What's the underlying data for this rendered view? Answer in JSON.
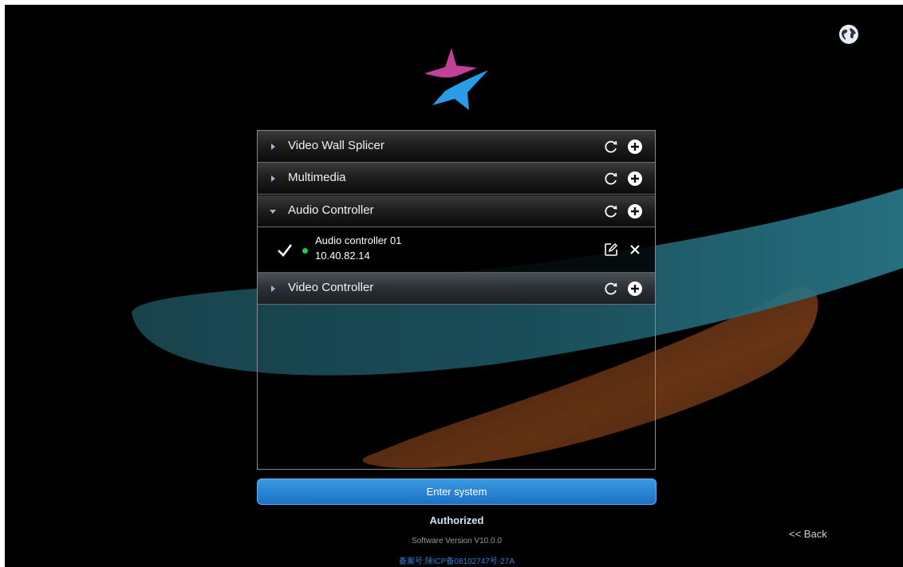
{
  "groups": [
    {
      "title": "Video Wall Splicer",
      "expanded": false
    },
    {
      "title": "Multimedia",
      "expanded": false
    },
    {
      "title": "Audio Controller",
      "expanded": true
    },
    {
      "title": "Video Controller",
      "expanded": false
    }
  ],
  "device": {
    "name": "Audio controller 01",
    "ip": "10.40.82.14",
    "status": "online",
    "selected": true
  },
  "enter_button_label": "Enter system",
  "status_text": "Authorized",
  "software_version": "Software Version V10.0.0",
  "icp_text": "备案号:陕ICP备08102747号-27A",
  "back_label": "<< Back",
  "icons": {
    "globe": "globe-icon",
    "refresh": "refresh-icon",
    "add": "plus-circle-icon",
    "edit": "edit-icon",
    "remove": "close-icon",
    "check": "checkmark-icon"
  },
  "colors": {
    "accent": "#1b70c4",
    "online": "#1ed13a",
    "logo_magenta": "#c0409a",
    "logo_blue": "#2a9be6"
  }
}
